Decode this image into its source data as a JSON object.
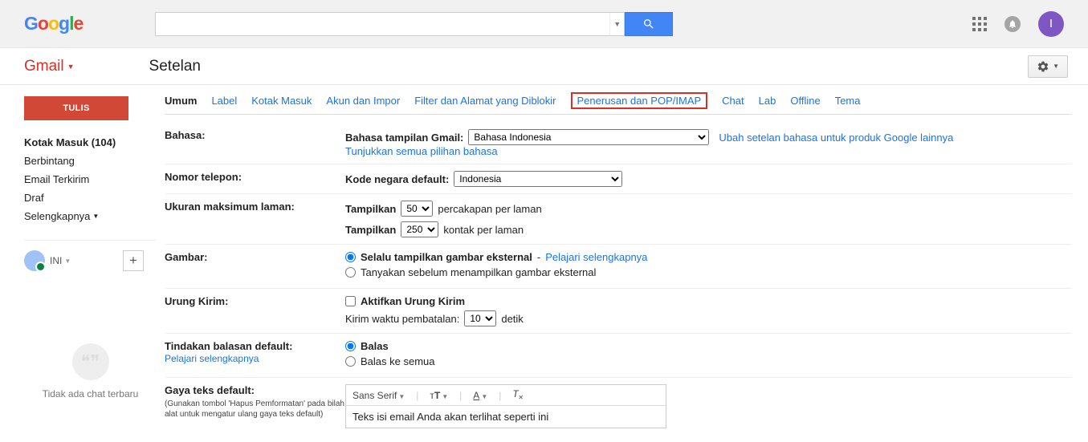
{
  "header": {
    "avatar_letter": "I",
    "page_title": "Setelan",
    "gmail_label": "Gmail"
  },
  "sidebar": {
    "compose": "TULIS",
    "items": [
      {
        "label": "Kotak Masuk (104)",
        "bold": true
      },
      {
        "label": "Berbintang"
      },
      {
        "label": "Email Terkirim"
      },
      {
        "label": "Draf"
      },
      {
        "label": "Selengkapnya"
      }
    ],
    "user": "INI",
    "hangouts_text": "Tidak ada chat terbaru"
  },
  "tabs": [
    {
      "label": "Umum",
      "active": true
    },
    {
      "label": "Label"
    },
    {
      "label": "Kotak Masuk"
    },
    {
      "label": "Akun dan Impor"
    },
    {
      "label": "Filter dan Alamat yang Diblokir"
    },
    {
      "label": "Penerusan dan POP/IMAP",
      "hl": true
    },
    {
      "label": "Chat"
    },
    {
      "label": "Lab"
    },
    {
      "label": "Offline"
    },
    {
      "label": "Tema"
    }
  ],
  "settings": {
    "bahasa": {
      "label": "Bahasa:",
      "field_label": "Bahasa tampilan Gmail:",
      "value": "Bahasa Indonesia",
      "side_link": "Ubah setelan bahasa untuk produk Google lainnya",
      "sub_link": "Tunjukkan semua pilihan bahasa"
    },
    "nomor": {
      "label": "Nomor telepon:",
      "field_label": "Kode negara default:",
      "value": "Indonesia"
    },
    "ukuran": {
      "label": "Ukuran maksimum laman:",
      "show1": "Tampilkan",
      "v1": "50",
      "after1": "percakapan per laman",
      "show2": "Tampilkan",
      "v2": "250",
      "after2": "kontak per laman"
    },
    "gambar": {
      "label": "Gambar:",
      "opt1": "Selalu tampilkan gambar eksternal",
      "opt1_link": "Pelajari selengkapnya",
      "opt2": "Tanyakan sebelum menampilkan gambar eksternal"
    },
    "urung": {
      "label": "Urung Kirim:",
      "chk": "Aktifkan Urung Kirim",
      "sub1": "Kirim waktu pembatalan:",
      "v": "10",
      "sub2": "detik"
    },
    "balasan": {
      "label": "Tindakan balasan default:",
      "sub_link": "Pelajari selengkapnya",
      "opt1": "Balas",
      "opt2": "Balas ke semua"
    },
    "gaya": {
      "label": "Gaya teks default:",
      "note": "(Gunakan tombol 'Hapus Pemformatan' pada bilah alat untuk mengatur ulang gaya teks default)",
      "font": "Sans Serif",
      "sample": "Teks isi email Anda akan terlihat seperti ini"
    }
  }
}
